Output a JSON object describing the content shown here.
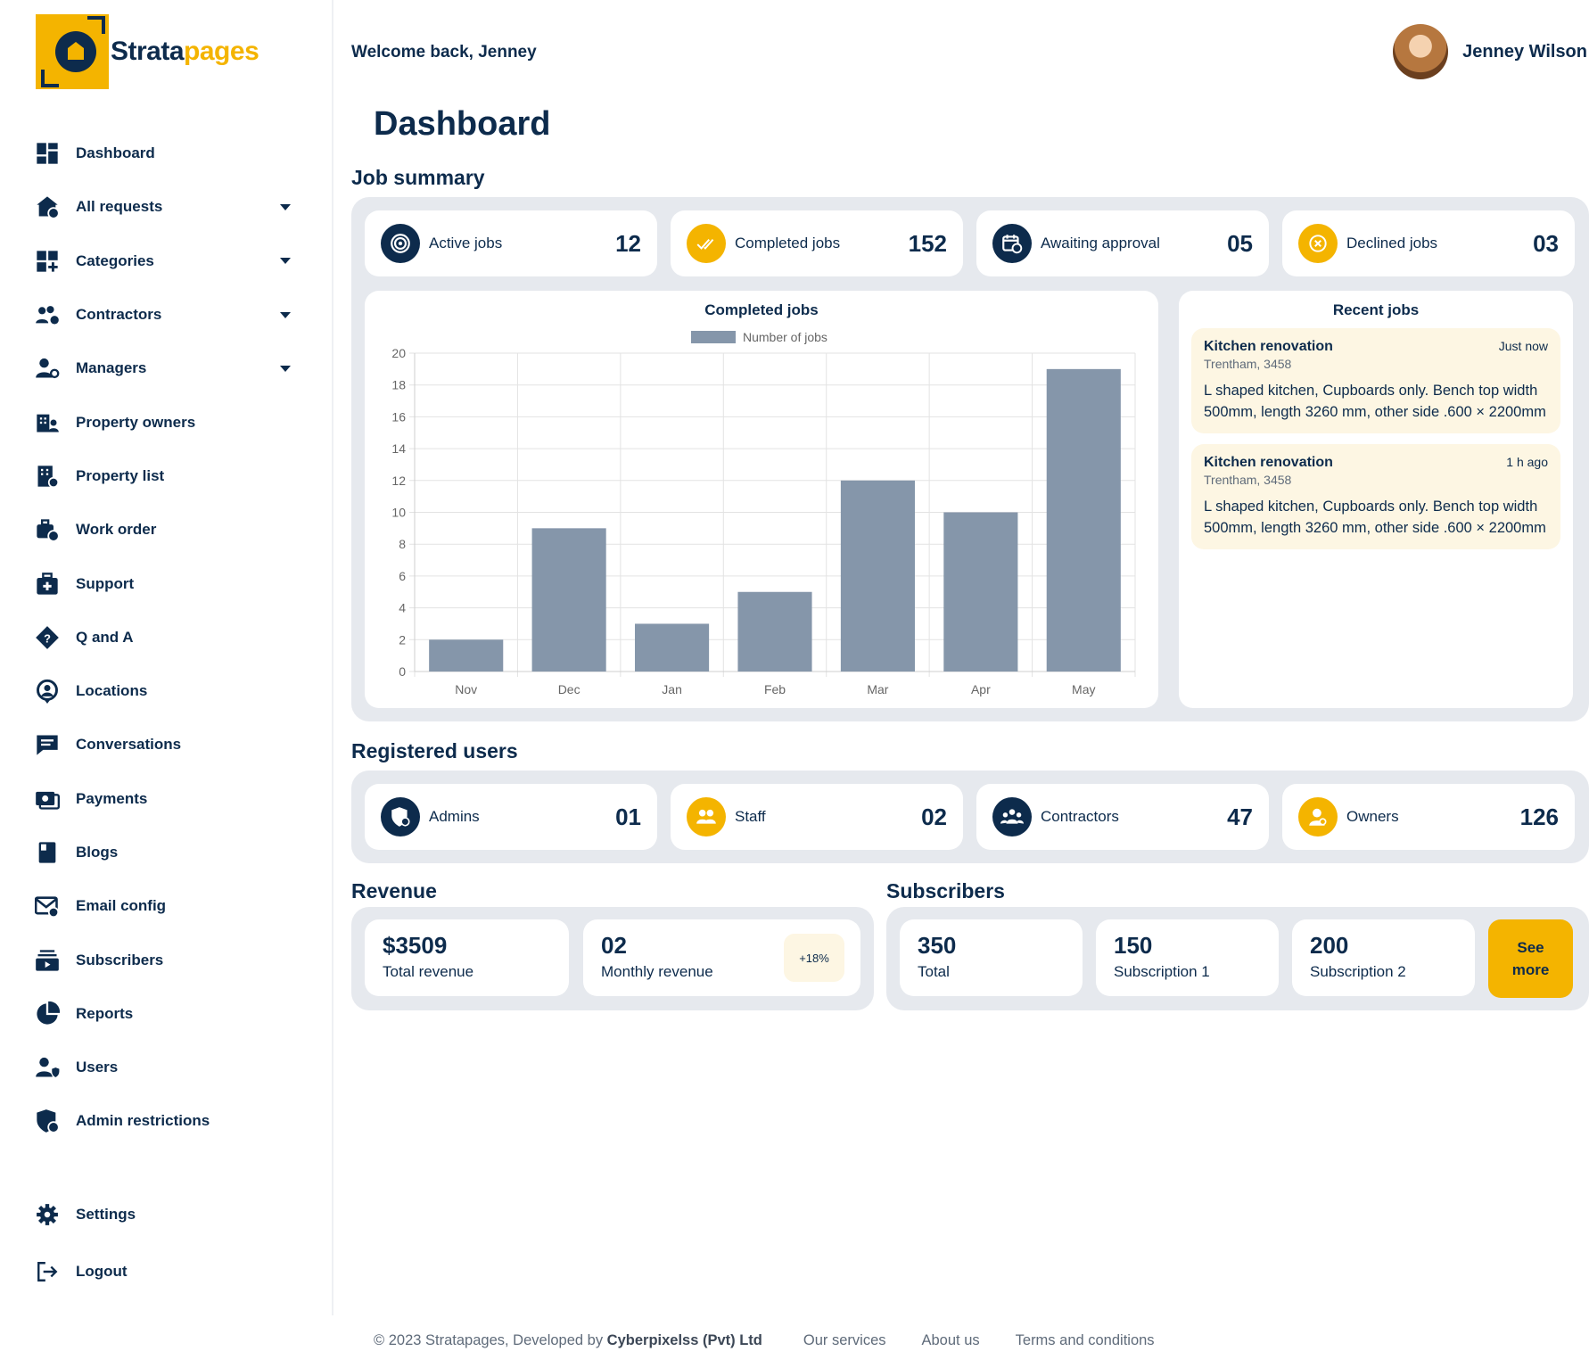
{
  "brand": {
    "part1": "Strata",
    "part2": "pages"
  },
  "header": {
    "welcome": "Welcome back, Jenney",
    "user_name": "Jenney Wilson"
  },
  "sidebar": {
    "items": [
      {
        "label": "Dashboard",
        "icon": "dashboard-icon",
        "caret": false
      },
      {
        "label": "All requests",
        "icon": "requests-icon",
        "caret": true
      },
      {
        "label": "Categories",
        "icon": "categories-icon",
        "caret": true
      },
      {
        "label": "Contractors",
        "icon": "contractors-icon",
        "caret": true
      },
      {
        "label": "Managers",
        "icon": "managers-icon",
        "caret": true
      },
      {
        "label": "Property owners",
        "icon": "property-owners-icon",
        "caret": false
      },
      {
        "label": "Property list",
        "icon": "property-list-icon",
        "caret": false
      },
      {
        "label": "Work order",
        "icon": "work-order-icon",
        "caret": false
      },
      {
        "label": "Support",
        "icon": "support-icon",
        "caret": false
      },
      {
        "label": "Q and A",
        "icon": "qa-icon",
        "caret": false
      },
      {
        "label": "Locations",
        "icon": "location-icon",
        "caret": false
      },
      {
        "label": "Conversations",
        "icon": "chat-icon",
        "caret": false
      },
      {
        "label": "Payments",
        "icon": "payments-icon",
        "caret": false
      },
      {
        "label": "Blogs",
        "icon": "blog-icon",
        "caret": false
      },
      {
        "label": "Email config",
        "icon": "email-icon",
        "caret": false
      },
      {
        "label": "Subscribers",
        "icon": "subscribers-icon",
        "caret": false
      },
      {
        "label": "Reports",
        "icon": "reports-icon",
        "caret": false
      },
      {
        "label": "Users",
        "icon": "users-icon",
        "caret": false
      },
      {
        "label": "Admin restrictions",
        "icon": "admin-restrictions-icon",
        "caret": false
      }
    ],
    "bottom": [
      {
        "label": "Settings",
        "icon": "gear-icon"
      },
      {
        "label": "Logout",
        "icon": "logout-icon"
      }
    ]
  },
  "page_title": "Dashboard",
  "job_summary": {
    "title": "Job summary",
    "cards": [
      {
        "label": "Active jobs",
        "value": "12",
        "icon": "target-icon",
        "color": "#0d2b4c"
      },
      {
        "label": "Completed jobs",
        "value": "152",
        "icon": "double-check-icon",
        "color": "#f4b400"
      },
      {
        "label": "Awaiting approval",
        "value": "05",
        "icon": "calendar-clock-icon",
        "color": "#0d2b4c"
      },
      {
        "label": "Declined jobs",
        "value": "03",
        "icon": "declined-icon",
        "color": "#f4b400"
      }
    ]
  },
  "chart_data": {
    "type": "bar",
    "title": "Completed jobs",
    "categories": [
      "Nov",
      "Dec",
      "Jan",
      "Feb",
      "Mar",
      "Apr",
      "May"
    ],
    "series": [
      {
        "name": "Number of jobs",
        "values": [
          2,
          9,
          3,
          5,
          12,
          10,
          19
        ]
      }
    ],
    "ylim": [
      0,
      20
    ],
    "yticks": [
      0,
      2,
      4,
      6,
      8,
      10,
      12,
      14,
      16,
      18,
      20
    ],
    "grid": true,
    "legend": "top-center",
    "bar_color": "#8596aa"
  },
  "recent_jobs": {
    "title": "Recent jobs",
    "items": [
      {
        "title": "Kitchen renovation",
        "time": "Just now",
        "location": "Trentham, 3458",
        "description": "L shaped kitchen, Cupboards only. Bench top width 500mm, length 3260 mm, other side .600 × 2200mm"
      },
      {
        "title": "Kitchen renovation",
        "time": "1 h ago",
        "location": "Trentham, 3458",
        "description": "L shaped kitchen, Cupboards only. Bench top width 500mm, length 3260 mm, other side .600 × 2200mm"
      }
    ]
  },
  "registered_users": {
    "title": "Registered users",
    "cards": [
      {
        "label": "Admins",
        "value": "01",
        "icon": "admin-shield-icon",
        "color": "#0d2b4c"
      },
      {
        "label": "Staff",
        "value": "02",
        "icon": "staff-icon",
        "color": "#f4b400"
      },
      {
        "label": "Contractors",
        "value": "47",
        "icon": "contractors-group-icon",
        "color": "#0d2b4c"
      },
      {
        "label": "Owners",
        "value": "126",
        "icon": "owner-icon",
        "color": "#f4b400"
      }
    ]
  },
  "revenue": {
    "title": "Revenue",
    "total_value": "$3509",
    "total_label": "Total revenue",
    "monthly_value": "02",
    "monthly_label": "Monthly revenue",
    "badge": "+18%"
  },
  "subscribers": {
    "title": "Subscribers",
    "cards": [
      {
        "value": "350",
        "label": "Total"
      },
      {
        "value": "150",
        "label": "Subscription 1"
      },
      {
        "value": "200",
        "label": "Subscription 2"
      }
    ],
    "see_more": "See more"
  },
  "footer": {
    "copyright": "© 2023 Stratapages, Developed by ",
    "developer": "Cyberpixelss (Pvt) Ltd",
    "links": [
      "Our services",
      "About us",
      "Terms and conditions"
    ]
  }
}
